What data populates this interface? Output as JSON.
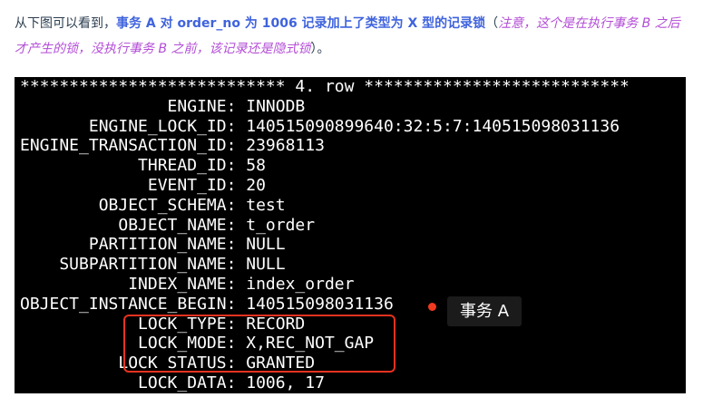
{
  "intro": {
    "part1": "从下图可以看到，",
    "highlight": "事务 A 对 order_no 为 1006 记录加上了类型为 X 型的记录锁",
    "paren_open": "（",
    "note": "注意，这个是在执行事务 B 之后才产生的锁，没执行事务 B 之前，该记录还是隐式锁",
    "paren_close": "）。"
  },
  "terminal": {
    "lines": [
      "*************************** 4. row ***************************",
      "               ENGINE: INNODB",
      "       ENGINE_LOCK_ID: 140515090899640:32:5:7:140515098031136",
      "ENGINE_TRANSACTION_ID: 23968113",
      "            THREAD_ID: 58",
      "             EVENT_ID: 20",
      "        OBJECT_SCHEMA: test",
      "          OBJECT_NAME: t_order",
      "       PARTITION_NAME: NULL",
      "    SUBPARTITION_NAME: NULL",
      "           INDEX_NAME: index_order",
      "OBJECT_INSTANCE_BEGIN: 140515098031136",
      "            LOCK_TYPE: RECORD",
      "            LOCK_MODE: X,REC_NOT_GAP",
      "          LOCK_STATUS: GRANTED",
      "            LOCK_DATA: 1006, 17"
    ]
  },
  "annotation": {
    "label": "事务 A",
    "colors": {
      "box": "#e8321f",
      "dot": "#f03a1f",
      "label_bg": "#1b1b1b"
    }
  }
}
